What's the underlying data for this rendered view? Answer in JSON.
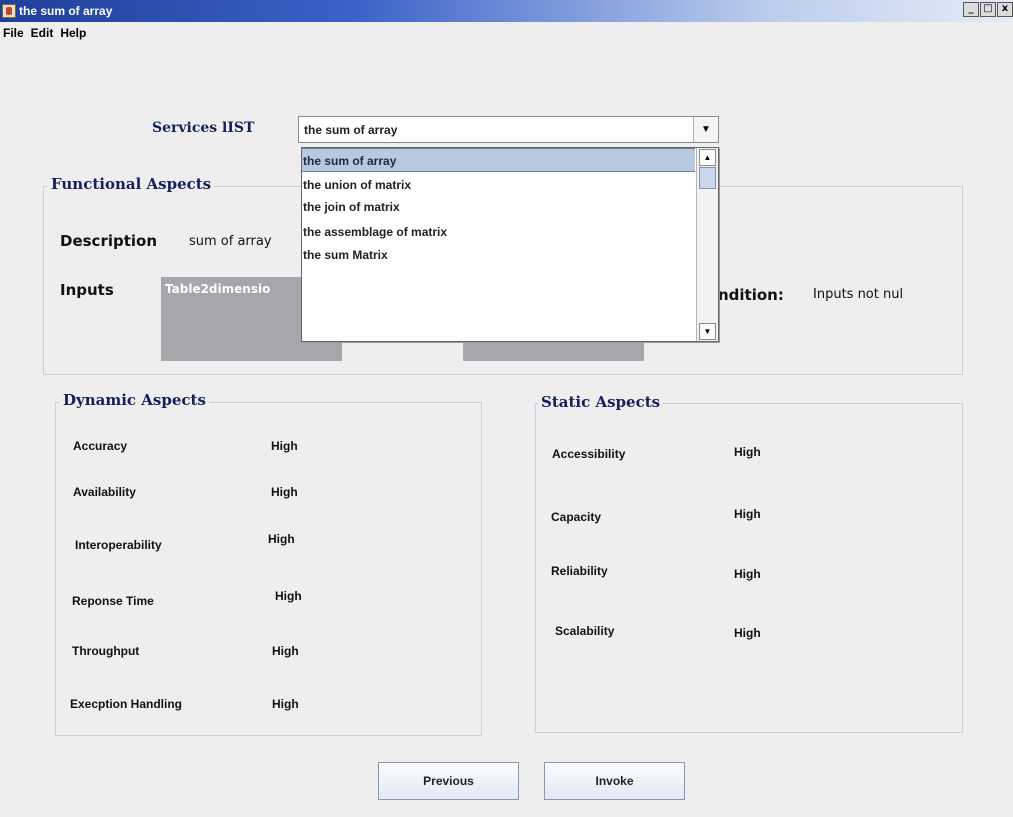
{
  "window": {
    "title": "the sum of array",
    "controls": [
      "_",
      "□",
      "x"
    ]
  },
  "menu": {
    "items": [
      "File",
      "Edit",
      "Help"
    ]
  },
  "services": {
    "label": "Services lIST",
    "selected": "the sum of array",
    "options": [
      "the sum of array",
      "the union of matrix",
      "the join of matrix",
      "the assemblage of matrix",
      "the sum Matrix"
    ]
  },
  "functional": {
    "title": "Functional Aspects",
    "description_label": "Description",
    "description_value": "sum of array",
    "inputs_label": "Inputs",
    "inputs_table_header": "Table2dimensio",
    "condition_label": "ndition:",
    "condition_value": "Inputs not nul"
  },
  "dynamic": {
    "title": "Dynamic Aspects",
    "items": [
      {
        "label": "Accuracy",
        "value": "High"
      },
      {
        "label": "Availability",
        "value": "High"
      },
      {
        "label": "Interoperability",
        "value": "High"
      },
      {
        "label": "Reponse Time",
        "value": "High"
      },
      {
        "label": "Throughput",
        "value": "High"
      },
      {
        "label": "Execption Handling",
        "value": "High"
      }
    ]
  },
  "static": {
    "title": "Static Aspects",
    "items": [
      {
        "label": "Accessibility",
        "value": "High"
      },
      {
        "label": "Capacity",
        "value": "High"
      },
      {
        "label": "Reliability",
        "value": "High"
      },
      {
        "label": "Scalability",
        "value": "High"
      }
    ]
  },
  "buttons": {
    "previous": "Previous",
    "invoke": "Invoke"
  },
  "colors": {
    "title_bar": "#1f3f9a",
    "label_navy": "#14205c",
    "selection": "#b8c8de",
    "table_gray": "#a7a7ab"
  }
}
